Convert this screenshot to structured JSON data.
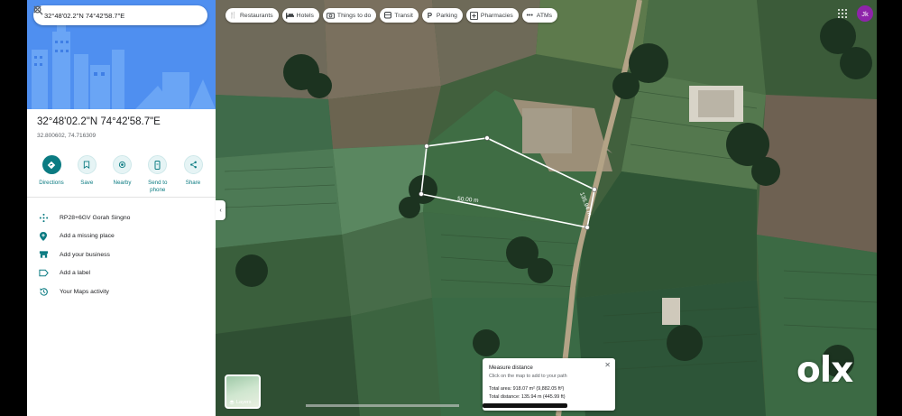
{
  "search": {
    "query": "32°48'02.2\"N 74°42'58.7\"E"
  },
  "place": {
    "title": "32°48'02.2\"N 74°42'58.7\"E",
    "coords": "32.800602, 74.716309"
  },
  "actions": [
    {
      "label": "Directions",
      "icon": "directions-icon"
    },
    {
      "label": "Save",
      "icon": "bookmark-icon"
    },
    {
      "label": "Nearby",
      "icon": "nearby-icon"
    },
    {
      "label": "Send to\nphone",
      "icon": "phone-icon"
    },
    {
      "label": "Share",
      "icon": "share-icon"
    }
  ],
  "details": [
    {
      "text": "RP28+6GV Gorah Singno",
      "icon": "plus-code-icon"
    },
    {
      "text": "Add a missing place",
      "icon": "add-place-icon"
    },
    {
      "text": "Add your business",
      "icon": "business-icon"
    },
    {
      "text": "Add a label",
      "icon": "label-icon"
    },
    {
      "text": "Your Maps activity",
      "icon": "history-icon"
    }
  ],
  "chips": [
    {
      "label": "Restaurants",
      "icon": "restaurant-icon"
    },
    {
      "label": "Hotels",
      "icon": "hotel-icon"
    },
    {
      "label": "Things to do",
      "icon": "camera-icon"
    },
    {
      "label": "Transit",
      "icon": "transit-icon"
    },
    {
      "label": "Parking",
      "icon": "parking-icon"
    },
    {
      "label": "Pharmacies",
      "icon": "pharmacy-icon"
    },
    {
      "label": "ATMs",
      "icon": "atm-icon"
    }
  ],
  "account": {
    "initials": "Jk",
    "color": "#8e24aa"
  },
  "measurement": {
    "segment_1_label": "50.00 m",
    "segment_2_label": "135.94 m"
  },
  "measure_panel": {
    "title": "Measure distance",
    "subtitle": "Click on the map to add to your path",
    "area": "Total area: 918.07 m² (9,882.05 ft²)",
    "distance": "Total distance: 135.94 m (445.99 ft)"
  },
  "layers": {
    "label": "Layers"
  },
  "watermark": "olx",
  "colors": {
    "accent": "#0b7b82",
    "hero": "#4f8ff0"
  }
}
